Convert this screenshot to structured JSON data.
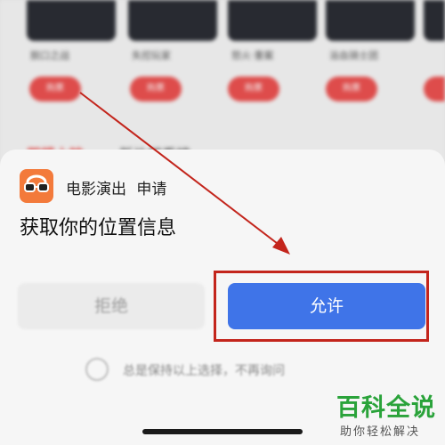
{
  "background": {
    "cards": [
      {
        "title": "脱口之战",
        "button": "购票"
      },
      {
        "title": "失控玩家",
        "button": "购票"
      },
      {
        "title": "怒火·重案",
        "button": "购票"
      },
      {
        "title": "浴血骑士团",
        "button": "购票"
      },
      {
        "title": "",
        "button": ""
      }
    ],
    "section_title": "即将上映",
    "section_subtitle": "新片想看榜"
  },
  "dialog": {
    "app_name": "电影演出",
    "request_label": "申请",
    "title": "获取你的位置信息",
    "deny_label": "拒绝",
    "allow_label": "允许",
    "remember_text": "总是保持以上选择，不再询问"
  },
  "icons": {
    "app": "glasses-icon",
    "radio": "radio-unchecked-icon"
  },
  "watermark": {
    "main": "百科全说",
    "sub": "助你轻松解决"
  },
  "colors": {
    "accent": "#3f74e8",
    "app_icon": "#f37a3b",
    "annotation": "#c3251c",
    "brand_red": "#e8504f",
    "watermark_green": "#2aa33a"
  }
}
